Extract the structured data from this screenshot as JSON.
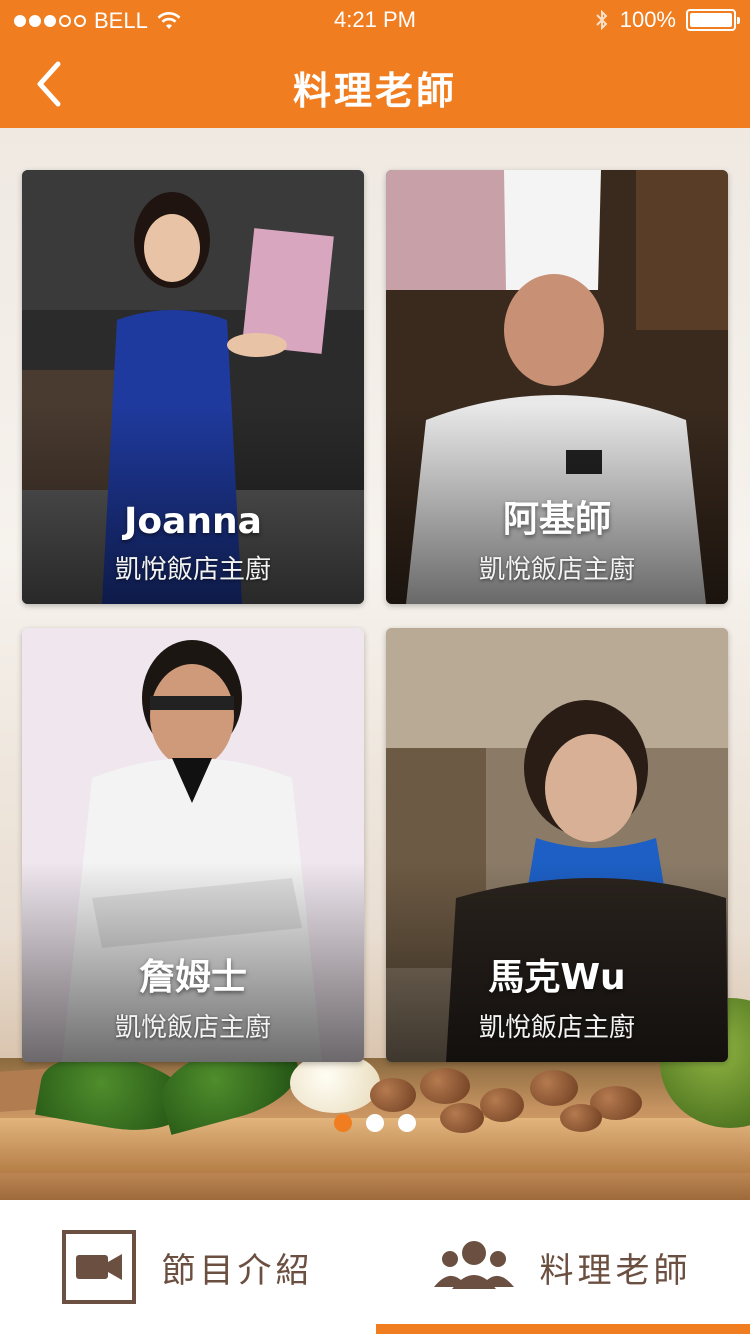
{
  "status_bar": {
    "carrier": "BELL",
    "time": "4:21 PM",
    "battery": "100%"
  },
  "nav": {
    "title": "料理老師"
  },
  "teachers": [
    {
      "name": "Joanna",
      "role": "凱悅飯店主廚"
    },
    {
      "name": "阿基師",
      "role": "凱悅飯店主廚"
    },
    {
      "name": "詹姆士",
      "role": "凱悅飯店主廚"
    },
    {
      "name": "馬克Wu",
      "role": "凱悅飯店主廚"
    }
  ],
  "pager": {
    "pages": 3,
    "active_index": 0
  },
  "tabs": [
    {
      "label": "節目介紹",
      "icon": "video-camera-icon",
      "active": false
    },
    {
      "label": "料理老師",
      "icon": "group-people-icon",
      "active": true
    }
  ],
  "colors": {
    "accent": "#f07d1f",
    "tab_text": "#6b4f40"
  }
}
